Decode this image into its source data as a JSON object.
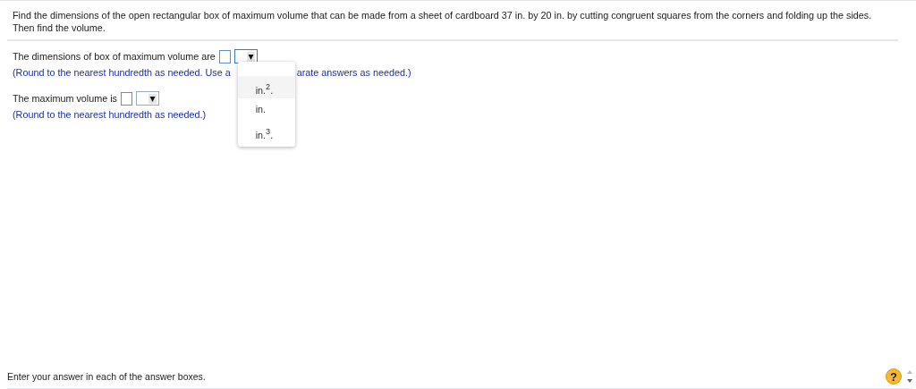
{
  "question": "Find the dimensions of the open rectangular box of maximum volume that can be made from a sheet of cardboard 37 in. by 20 in. by cutting congruent squares from the corners and folding up the sides. Then find the volume.",
  "parts": [
    {
      "prompt": "The dimensions of box of maximum volume are",
      "hint_before": "(Round to the nearest hundredth as needed. Use a",
      "hint_after": "arate answers as needed.)",
      "menu_open": true
    },
    {
      "prompt": "The maximum volume is",
      "hint_before": "(Round to the nearest hundredth as needed.)",
      "menu_open": false
    }
  ],
  "unit_menu": [
    {
      "label": "in.$^{2}$.",
      "selected": true
    },
    {
      "label": "in.",
      "selected": false
    },
    {
      "label": "in.$^{3}$.",
      "selected": false
    }
  ],
  "footer": "Enter your answer in each of the answer boxes.",
  "help_label": "?"
}
